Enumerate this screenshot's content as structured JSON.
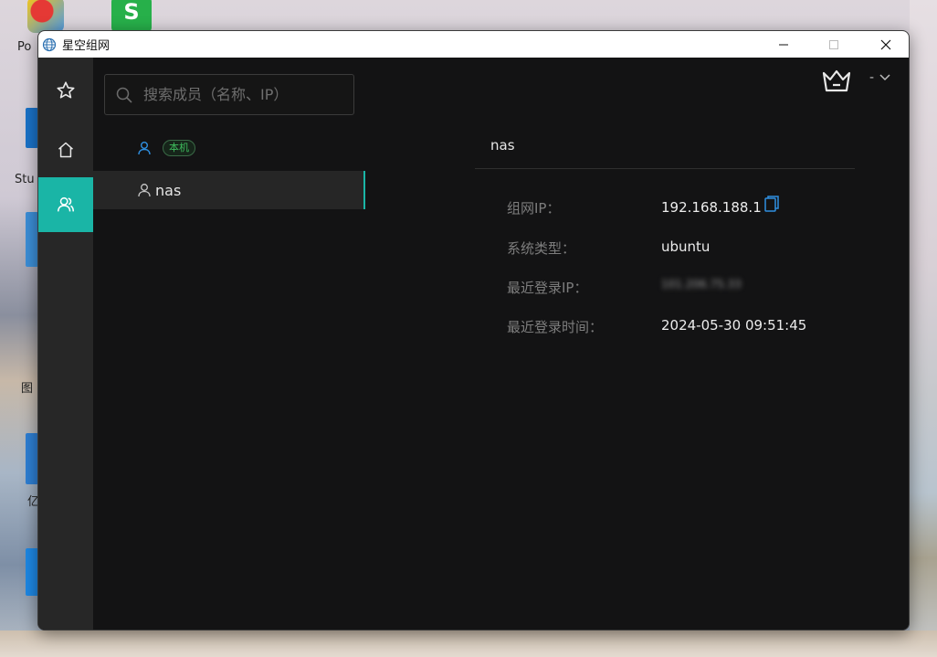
{
  "desktop": {
    "labels": [
      "Po",
      "Stu",
      "图",
      "亿"
    ]
  },
  "window": {
    "title": "星空组网",
    "controls": {
      "minimize": "—",
      "maximize": "☐",
      "close": "✕"
    }
  },
  "rail": {
    "items": [
      {
        "name": "favorites",
        "icon": "star-icon"
      },
      {
        "name": "home",
        "icon": "home-icon"
      },
      {
        "name": "members",
        "icon": "users-icon",
        "active": true
      }
    ]
  },
  "search": {
    "placeholder": "搜索成员（名称、IP）",
    "value": ""
  },
  "members": [
    {
      "name": "",
      "badge": "本机",
      "selected": false
    },
    {
      "name": "nas",
      "badge": "",
      "selected": true
    }
  ],
  "user_menu": {
    "label": "-",
    "caret": "⌵"
  },
  "detail": {
    "title": "nas",
    "rows": [
      {
        "label": "组网IP：",
        "value": "192.168.188.1",
        "copyable": true
      },
      {
        "label": "系统类型：",
        "value": "ubuntu"
      },
      {
        "label": "最近登录IP：",
        "value": "101.206.75.33",
        "blurred": true
      },
      {
        "label": "最近登录时间：",
        "value": "2024-05-30 09:51:45"
      }
    ]
  },
  "colors": {
    "accent": "#1ab5a6",
    "badge": "#3ebd5d",
    "copy": "#2f8fe0"
  }
}
